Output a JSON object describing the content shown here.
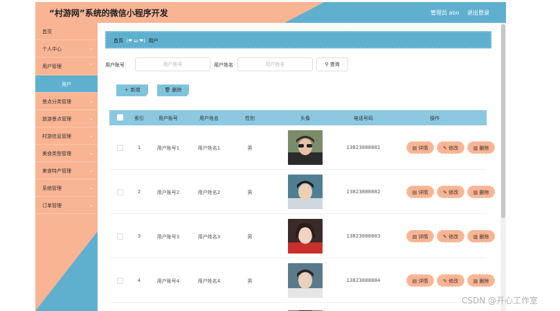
{
  "header": {
    "title": "“村游网”系统的微信小程序开发",
    "user": "管理员 abo",
    "logout": "退出登录"
  },
  "sidebar": {
    "items": [
      {
        "label": "首页",
        "chevron": false
      },
      {
        "label": "个人中心",
        "chevron": true
      },
      {
        "label": "用户管理",
        "chevron": true
      },
      {
        "label": "用户",
        "chevron": false,
        "sub": true
      },
      {
        "label": "景点分类管理",
        "chevron": true
      },
      {
        "label": "旅游景点管理",
        "chevron": true
      },
      {
        "label": "村游信息管理",
        "chevron": true
      },
      {
        "label": "美食类型管理",
        "chevron": true
      },
      {
        "label": "美食特产管理",
        "chevron": true
      },
      {
        "label": "系统管理",
        "chevron": true
      },
      {
        "label": "订单管理",
        "chevron": true
      }
    ]
  },
  "breadcrumb": {
    "home": "首页",
    "emoji": "(❤ ω ❤)",
    "current": "用户"
  },
  "search": {
    "account_label": "用户账号",
    "account_placeholder": "用户账号",
    "name_label": "用户姓名",
    "name_placeholder": "用户姓名",
    "button": "查询"
  },
  "actions": {
    "add": "新增",
    "delete": "删除"
  },
  "table": {
    "headers": [
      "索引",
      "用户账号",
      "用户姓名",
      "性别",
      "头像",
      "电话号码",
      "操作"
    ],
    "rows": [
      {
        "index": "1",
        "account": "用户账号1",
        "name": "用户姓名1",
        "gender": "男",
        "phone": "13823888881"
      },
      {
        "index": "2",
        "account": "用户账号2",
        "name": "用户姓名2",
        "gender": "男",
        "phone": "13823888882"
      },
      {
        "index": "3",
        "account": "用户账号3",
        "name": "用户姓名3",
        "gender": "男",
        "phone": "13823888883"
      },
      {
        "index": "4",
        "account": "用户账号4",
        "name": "用户姓名4",
        "gender": "男",
        "phone": "13823888884"
      }
    ],
    "row_buttons": {
      "detail": "详情",
      "edit": "修改",
      "delete": "删除"
    }
  },
  "watermark": "CSDN @开心工作室",
  "colors": {
    "accent_orange": "#f9b493",
    "accent_blue": "#5fb0cf",
    "table_header": "#8cc8e0"
  }
}
